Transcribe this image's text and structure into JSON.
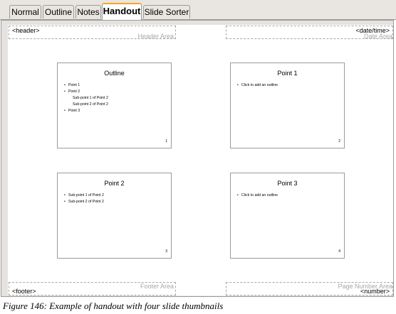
{
  "tabs": [
    {
      "label": "Normal"
    },
    {
      "label": "Outline"
    },
    {
      "label": "Notes"
    },
    {
      "label": "Handout"
    },
    {
      "label": "Slide Sorter"
    }
  ],
  "active_tab": "Handout",
  "areas": {
    "header": {
      "placeholder": "<header>",
      "name": "Header Area"
    },
    "date": {
      "placeholder": "<date/time>",
      "name": "Date Area"
    },
    "footer": {
      "placeholder": "<footer>",
      "name": "Footer Area"
    },
    "pagenum": {
      "placeholder": "<number>",
      "name": "Page Number Area"
    }
  },
  "slides": [
    {
      "title": "Outline",
      "bullets": [
        "Point 1",
        "Point 2"
      ],
      "subs": [
        "Sub-point 1 of Point 2",
        "Sub-point 2 of Point 2"
      ],
      "bullet3": "Point 3",
      "number": "1"
    },
    {
      "title": "Point 1",
      "bullets": [
        "Click to add an outline"
      ],
      "number": "2"
    },
    {
      "title": "Point 2",
      "bullets": [
        "Sub-point 1 of Point 2",
        "Sub-point 2 of Point 2"
      ],
      "number": "3"
    },
    {
      "title": "Point 3",
      "bullets": [
        "Click to add an outline"
      ],
      "number": "4"
    }
  ],
  "bullet_glyph": "•",
  "caption": "Figure 146: Example of handout with four slide thumbnails"
}
